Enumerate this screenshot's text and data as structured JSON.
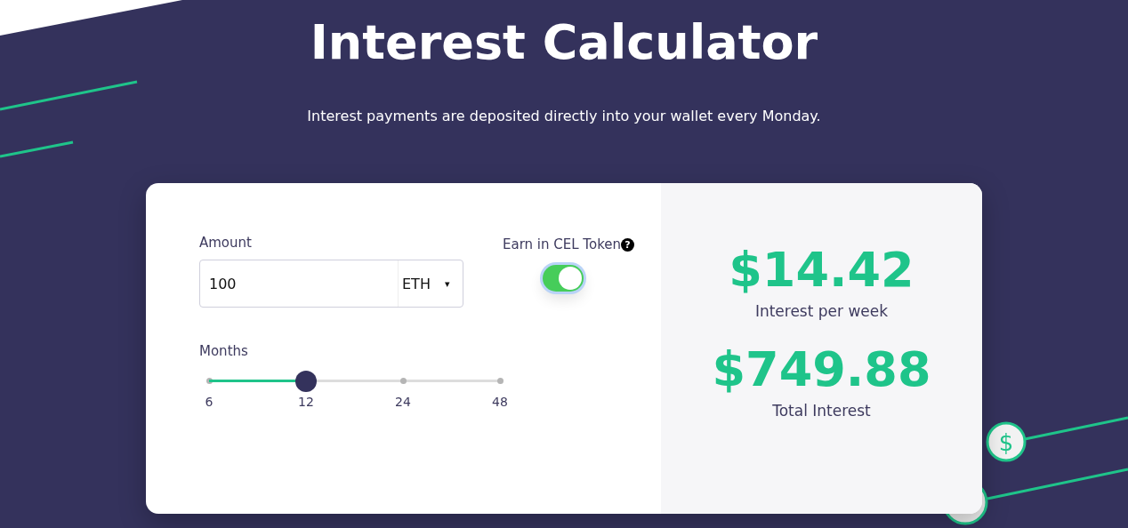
{
  "title": "Interest Calculator",
  "subtitle": "Interest payments are deposited directly into your wallet every Monday.",
  "amount": {
    "label": "Amount",
    "value": "100",
    "currency": "ETH",
    "caret": "▾"
  },
  "cel_token": {
    "label": "Earn in CEL Token",
    "help": "?",
    "on": true
  },
  "months": {
    "label": "Months",
    "level": 0.333,
    "ticks": [
      "6",
      "12",
      "24",
      "48"
    ]
  },
  "results": [
    {
      "value": "$14.42",
      "label": "Interest per week"
    },
    {
      "value": "$749.88",
      "label": "Total Interest"
    }
  ],
  "coin_symbol": "$"
}
